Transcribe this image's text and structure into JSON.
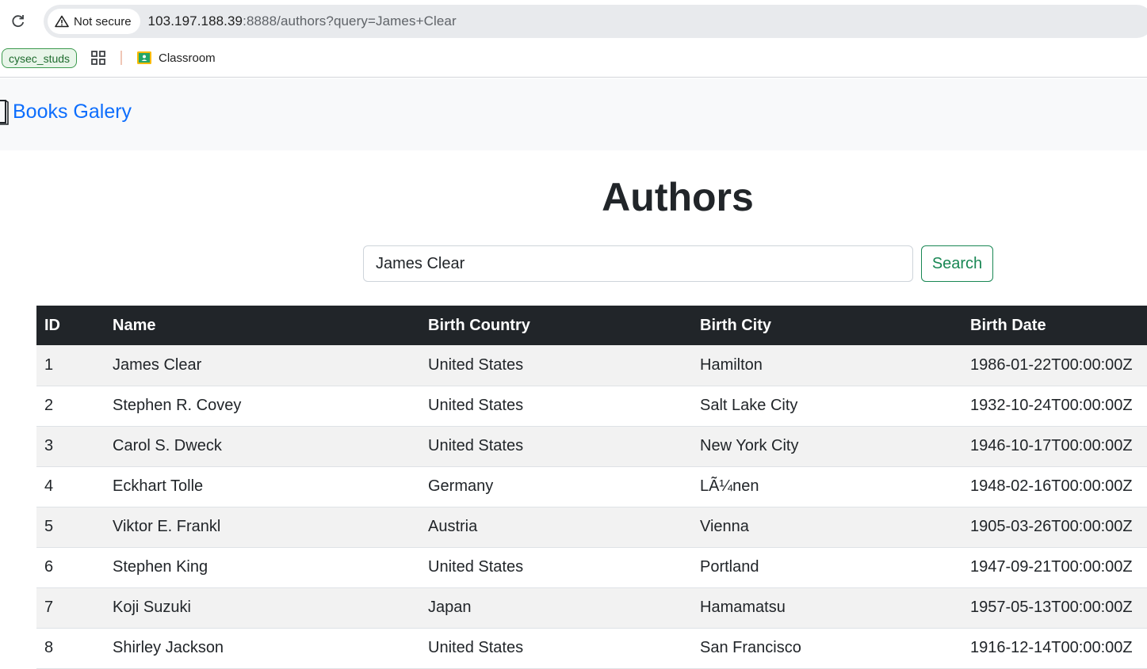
{
  "browser": {
    "security_label": "Not secure",
    "url_host": "103.197.188.39",
    "url_rest": ":8888/authors?query=James+Clear",
    "profile_chip": "cysec_studs",
    "bookmarks": [
      {
        "label": "Classroom",
        "icon": "google-classroom-icon"
      }
    ]
  },
  "navbar": {
    "brand": "Books Galery",
    "brand_icon": "book-icon"
  },
  "page": {
    "title": "Authors"
  },
  "search": {
    "value": "James Clear",
    "button_label": "Search"
  },
  "table": {
    "headers": [
      "ID",
      "Name",
      "Birth Country",
      "Birth City",
      "Birth Date"
    ],
    "rows": [
      [
        "1",
        "James Clear",
        "United States",
        "Hamilton",
        "1986-01-22T00:00:00Z"
      ],
      [
        "2",
        "Stephen R. Covey",
        "United States",
        "Salt Lake City",
        "1932-10-24T00:00:00Z"
      ],
      [
        "3",
        "Carol S. Dweck",
        "United States",
        "New York City",
        "1946-10-17T00:00:00Z"
      ],
      [
        "4",
        "Eckhart Tolle",
        "Germany",
        "LÃ¼nen",
        "1948-02-16T00:00:00Z"
      ],
      [
        "5",
        "Viktor E. Frankl",
        "Austria",
        "Vienna",
        "1905-03-26T00:00:00Z"
      ],
      [
        "6",
        "Stephen King",
        "United States",
        "Portland",
        "1947-09-21T00:00:00Z"
      ],
      [
        "7",
        "Koji Suzuki",
        "Japan",
        "Hamamatsu",
        "1957-05-13T00:00:00Z"
      ],
      [
        "8",
        "Shirley Jackson",
        "United States",
        "San Francisco",
        "1916-12-14T00:00:00Z"
      ]
    ]
  },
  "colors": {
    "brand_link": "#0d6efd",
    "search_button": "#198754",
    "table_header_bg": "#212529",
    "navbar_bg": "#f8f9fa"
  }
}
